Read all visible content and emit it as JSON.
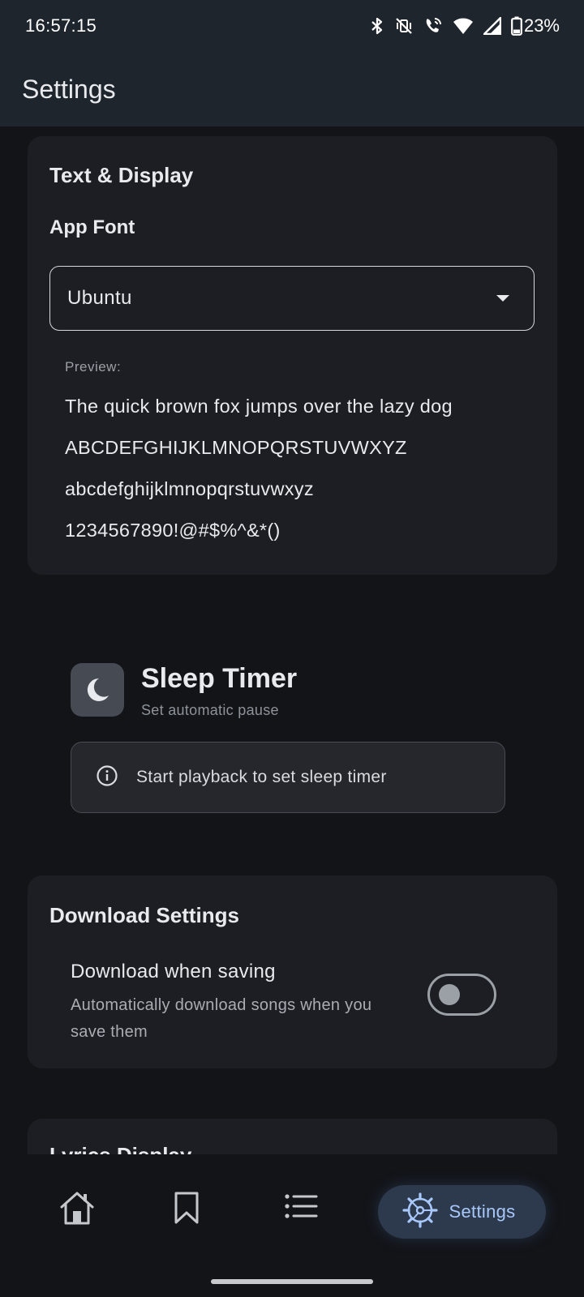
{
  "status_bar": {
    "time": "16:57:15",
    "battery": "23%",
    "icons": [
      "bluetooth-icon",
      "vibrate-off-icon",
      "wifi-calling-icon",
      "wifi-icon",
      "signal-icon",
      "battery-icon"
    ]
  },
  "app_bar": {
    "title": "Settings"
  },
  "text_display": {
    "title": "Text & Display",
    "font_label": "App Font",
    "font_value": "Ubuntu",
    "preview_label": "Preview:",
    "preview_lines": [
      "The quick brown fox jumps over the lazy dog",
      "ABCDEFGHIJKLMNOPQRSTUVWXYZ",
      "abcdefghijklmnopqrstuvwxyz",
      "1234567890!@#$%^&*()"
    ]
  },
  "sleep_timer": {
    "title": "Sleep Timer",
    "subtitle": "Set automatic pause",
    "info": "Start playback to set sleep timer"
  },
  "download_settings": {
    "title": "Download Settings",
    "option_title": "Download when saving",
    "option_subtitle": "Automatically download songs when you save them",
    "toggle_on": false
  },
  "lyrics_display": {
    "title": "Lyrics Display"
  },
  "bottom_nav": {
    "items": [
      {
        "icon": "home-icon",
        "label": ""
      },
      {
        "icon": "bookmark-icon",
        "label": ""
      },
      {
        "icon": "list-icon",
        "label": ""
      },
      {
        "icon": "settings-icon",
        "label": "Settings",
        "active": true
      }
    ]
  },
  "colors": {
    "background": "#121418",
    "surface": "#1c1e23",
    "app_bar": "#1f252d",
    "active_pill": "#2d3a4d",
    "accent": "#a8c7fa"
  }
}
